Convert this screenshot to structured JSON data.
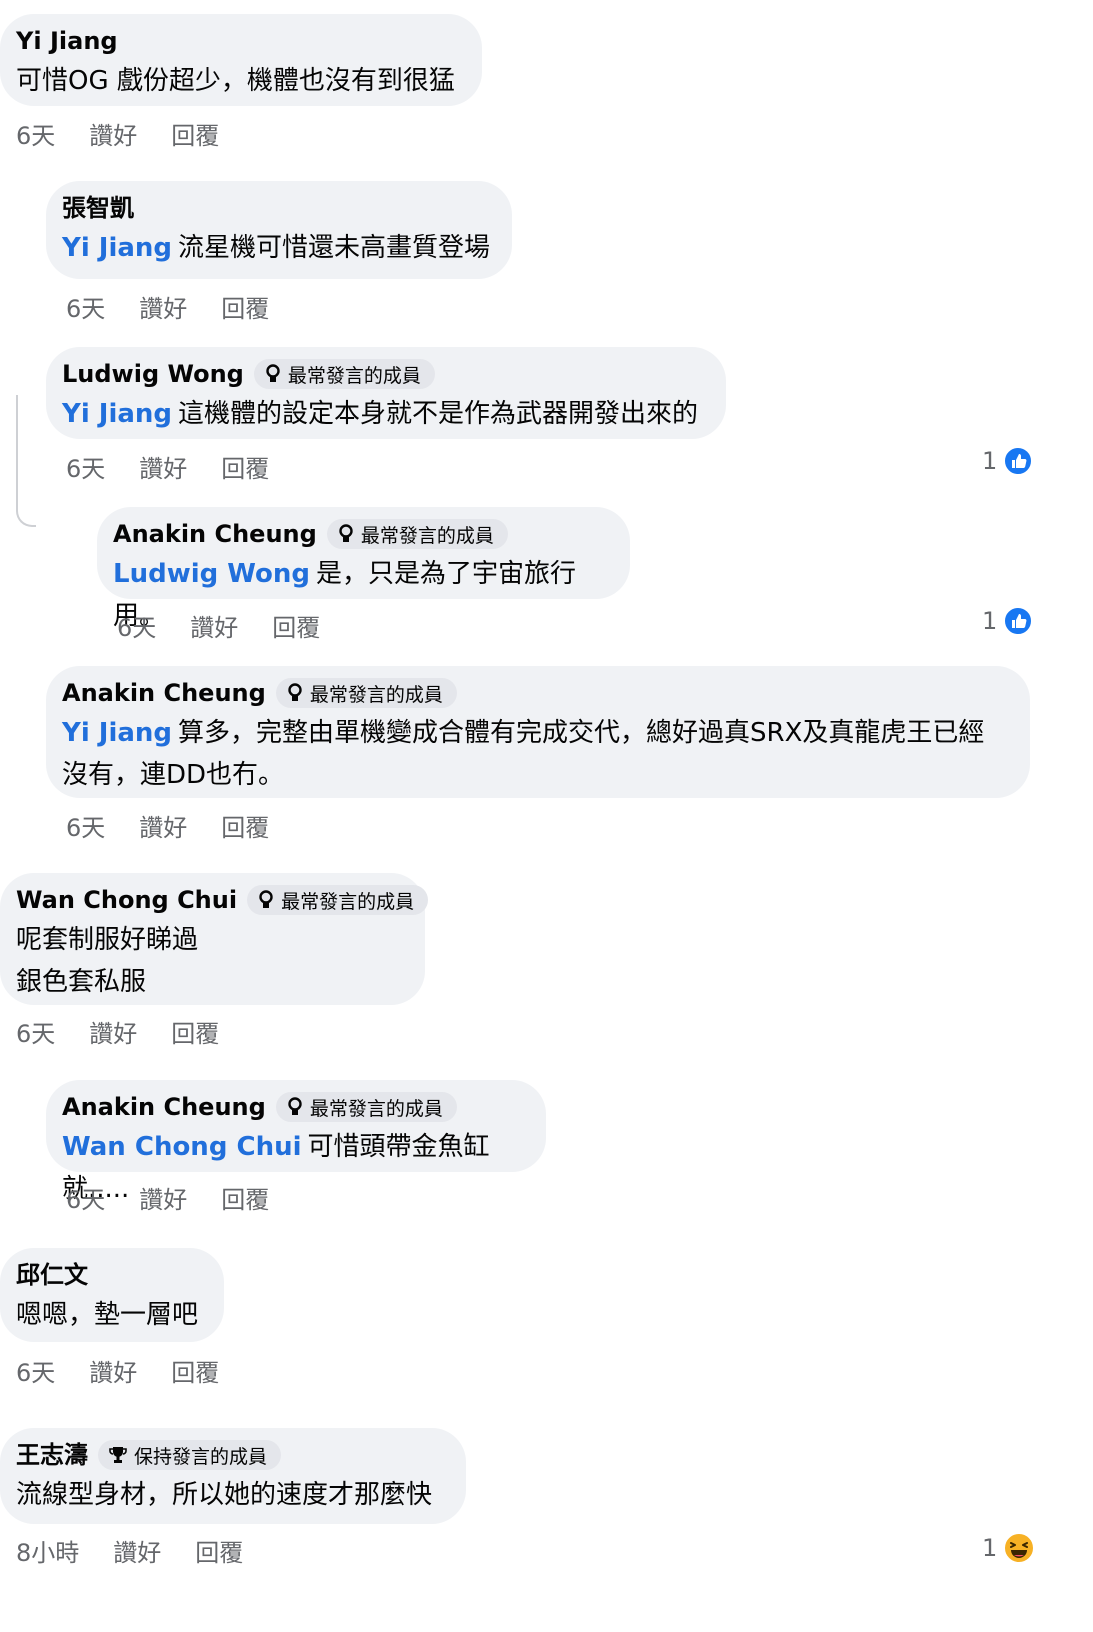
{
  "labels": {
    "like": "讚好",
    "reply": "回覆"
  },
  "colors": {
    "bubble": "#f0f2f5",
    "mention": "#216fdb",
    "meta": "#65676b",
    "like_blue": "#1877f2"
  },
  "comments": [
    {
      "author": "Yi Jiang",
      "badge": "",
      "mention": "",
      "text": [
        "可惜OG 戲份超少，機體也沒有到很猛"
      ],
      "time": "6天",
      "reaction_count": "",
      "reaction_icon": ""
    },
    {
      "author": "張智凱",
      "badge": "",
      "mention": "Yi Jiang",
      "text": [
        "流星機可惜還未高畫質登場"
      ],
      "time": "6天",
      "reaction_count": "",
      "reaction_icon": ""
    },
    {
      "author": "Ludwig Wong",
      "badge": "最常發言的成員",
      "mention": "Yi Jiang",
      "text": [
        "這機體的設定本身就不是作為武器開發出來的"
      ],
      "time": "6天",
      "reaction_count": "1",
      "reaction_icon": "like-icon"
    },
    {
      "author": "Anakin Cheung",
      "badge": "最常發言的成員",
      "mention": "Ludwig Wong",
      "text": [
        "是，只是為了宇宙旅行用。"
      ],
      "time": "6天",
      "reaction_count": "1",
      "reaction_icon": "like-icon"
    },
    {
      "author": "Anakin Cheung",
      "badge": "最常發言的成員",
      "mention": "Yi Jiang",
      "text": [
        "算多，完整由單機變成合體有完成交代，總好過真SRX及真龍虎王已經",
        "沒有，連DD也冇。"
      ],
      "time": "6天",
      "reaction_count": "",
      "reaction_icon": ""
    },
    {
      "author": "Wan Chong Chui",
      "badge": "最常發言的成員",
      "mention": "",
      "text": [
        "呢套制服好睇過",
        "銀色套私服"
      ],
      "time": "6天",
      "reaction_count": "",
      "reaction_icon": ""
    },
    {
      "author": "Anakin Cheung",
      "badge": "最常發言的成員",
      "mention": "Wan Chong Chui",
      "text": [
        "可惜頭帶金魚缸就....."
      ],
      "time": "6天",
      "reaction_count": "",
      "reaction_icon": ""
    },
    {
      "author": "邱仁文",
      "badge": "",
      "mention": "",
      "text": [
        "嗯嗯，墊一層吧"
      ],
      "time": "6天",
      "reaction_count": "",
      "reaction_icon": ""
    },
    {
      "author": "王志濤",
      "badge": "保持發言的成員",
      "mention": "",
      "text": [
        "流線型身材，所以她的速度才那麼快"
      ],
      "time": "8小時",
      "reaction_count": "1",
      "reaction_icon": "haha-icon"
    }
  ]
}
